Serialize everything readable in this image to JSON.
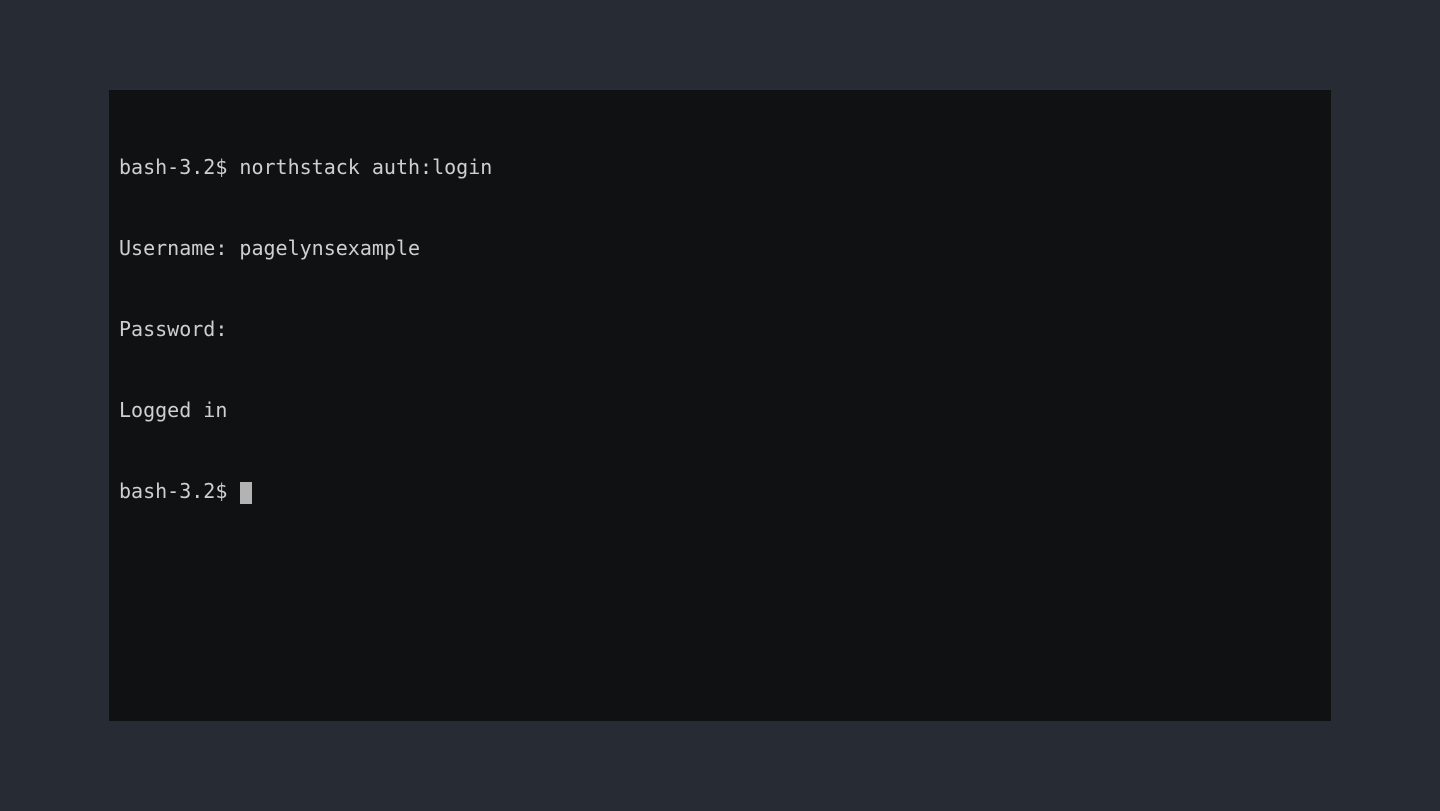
{
  "terminal": {
    "lines": [
      {
        "prompt": "bash-3.2$ ",
        "text": "northstack auth:login"
      },
      {
        "prompt": "",
        "text": "Username: pagelynsexample"
      },
      {
        "prompt": "",
        "text": "Password:"
      },
      {
        "prompt": "",
        "text": "Logged in"
      },
      {
        "prompt": "bash-3.2$ ",
        "text": "",
        "cursor": true
      }
    ]
  }
}
